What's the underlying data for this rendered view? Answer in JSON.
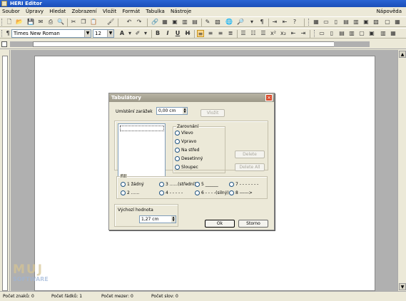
{
  "window": {
    "title": "HERI Editor"
  },
  "menu": {
    "items": [
      "Soubor",
      "Úpravy",
      "Hledat",
      "Zobrazení",
      "Vložit",
      "Formát",
      "Tabulka",
      "Nástroje"
    ],
    "help": "Nápověda"
  },
  "format_toolbar": {
    "style_value": "Times New Roman",
    "size_value": "12"
  },
  "dialog": {
    "title": "Tabulátory",
    "position_label": "Umístění zarážek",
    "position_value": "0,00 cm",
    "set_button": "Vložit",
    "alignment": {
      "title": "Zarovnání",
      "options": [
        "Vlevo",
        "Vpravo",
        "Na střed",
        "Desetinný",
        "Sloupec"
      ]
    },
    "delete_button": "Delete",
    "delete_all_button": "Delete All",
    "fill": {
      "title": "Fill",
      "options": [
        "1 žádný",
        "3 ......(střední)",
        "5 ______",
        "7 - - - - - - -",
        "2 ......",
        "4 - - - - -",
        "6 - - - -(silný)",
        "8 ------>"
      ]
    },
    "default_label": "Výchozí hodnota",
    "default_value": "1,27 cm",
    "ok_button": "Ok",
    "cancel_button": "Storno"
  },
  "status": {
    "chars": "Počet znaků: 0",
    "lines": "Počet řádků: 1",
    "spaces": "Počet mezer: 0",
    "words": "Počet slov: 0"
  },
  "watermark": {
    "line1": "MUJ",
    "line2": "SOFTWARE"
  }
}
